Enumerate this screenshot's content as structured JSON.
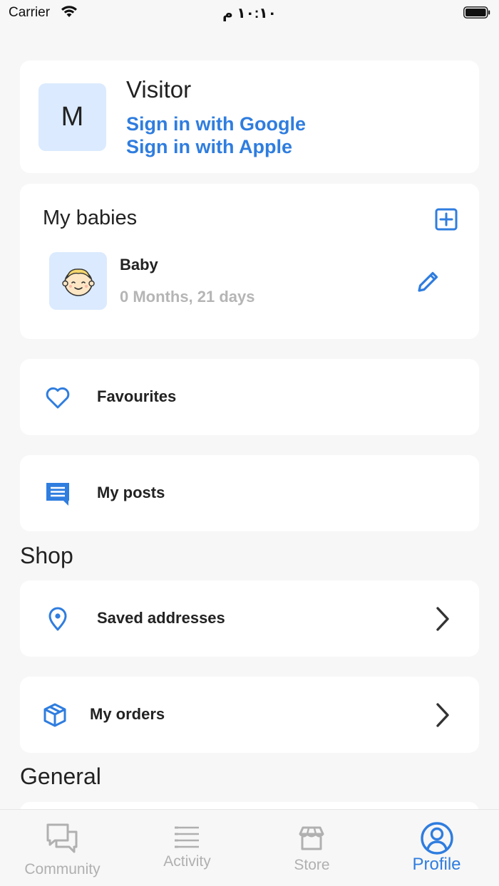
{
  "status_bar": {
    "carrier": "Carrier",
    "time": "١٠:١٠ م"
  },
  "profile": {
    "avatar_letter": "M",
    "name": "Visitor",
    "sign_in_google": "Sign in with Google",
    "sign_in_apple": "Sign in with Apple"
  },
  "babies": {
    "title": "My babies",
    "items": [
      {
        "name": "Baby",
        "age": "0 Months, 21 days"
      }
    ]
  },
  "menu": {
    "favourites": "Favourites",
    "my_posts": "My posts",
    "saved_addresses": "Saved addresses",
    "my_orders": "My orders"
  },
  "sections": {
    "shop": "Shop",
    "general": "General"
  },
  "tabs": [
    {
      "label": "Community",
      "icon": "chat-bubbles-icon",
      "active": false
    },
    {
      "label": "Activity",
      "icon": "list-icon",
      "active": false
    },
    {
      "label": "Store",
      "icon": "store-icon",
      "active": false
    },
    {
      "label": "Profile",
      "icon": "profile-circle-icon",
      "active": true
    }
  ],
  "colors": {
    "accent": "#2f7ddf",
    "avatar_bg": "#dbeafe",
    "background": "#f7f7f7",
    "muted": "#b5b5b5"
  }
}
